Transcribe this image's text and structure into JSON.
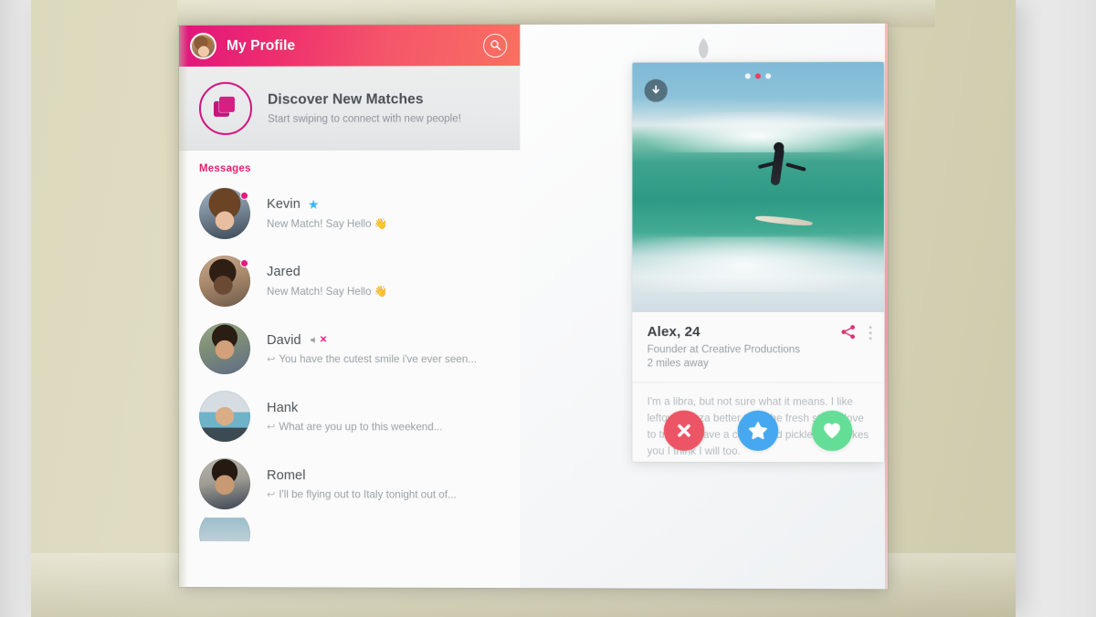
{
  "app": {
    "brand_icon": "flame-icon",
    "accent_pink": "#e0147e",
    "accent_coral": "#f97060"
  },
  "sidebar": {
    "header": {
      "title": "My Profile",
      "avatar_icon": "user-avatar",
      "search_icon": "search-icon"
    },
    "discover": {
      "icon": "stacked-cards-icon",
      "title": "Discover New Matches",
      "subtitle": "Start swiping to connect with new people!"
    },
    "messages_label": "Messages",
    "messages": [
      {
        "name": "Kevin",
        "preview": "New Match! Say Hello 👋",
        "badge": "star",
        "unread": true,
        "reply": false
      },
      {
        "name": "Jared",
        "preview": "New Match! Say Hello 👋",
        "badge": "none",
        "unread": true,
        "reply": false
      },
      {
        "name": "David",
        "preview": "You have the cutest smile i've ever seen...",
        "badge": "muted",
        "unread": false,
        "reply": true
      },
      {
        "name": "Hank",
        "preview": "What are you up to this weekend...",
        "badge": "none",
        "unread": false,
        "reply": true
      },
      {
        "name": "Romel",
        "preview": "I'll be flying out to Italy tonight out of...",
        "badge": "none",
        "unread": false,
        "reply": true
      }
    ]
  },
  "profile_card": {
    "photo": {
      "alt": "surfer-riding-wave-photo",
      "download_icon": "download-arrow-icon",
      "dots": 3,
      "active_dot_index": 1,
      "active_dot_color": "#ee4060"
    },
    "name": "Alex, 24",
    "job": "Founder at Creative Productions",
    "distance": "2 miles away",
    "share_icon": "share-icon",
    "menu_icon": "kebab-menu-icon",
    "bio": "I'm a libra, but not sure what it means. I like leftover pizza better than the fresh stuff. I love to travel. I have a cat named pickles, if he likes you I think I will too.",
    "actions": {
      "nope_label": "nope-x-icon",
      "nope_color": "#ec5565",
      "super_label": "superlike-star-icon",
      "super_color": "#46a8f0",
      "like_label": "like-heart-icon",
      "like_color": "#64de96"
    }
  }
}
